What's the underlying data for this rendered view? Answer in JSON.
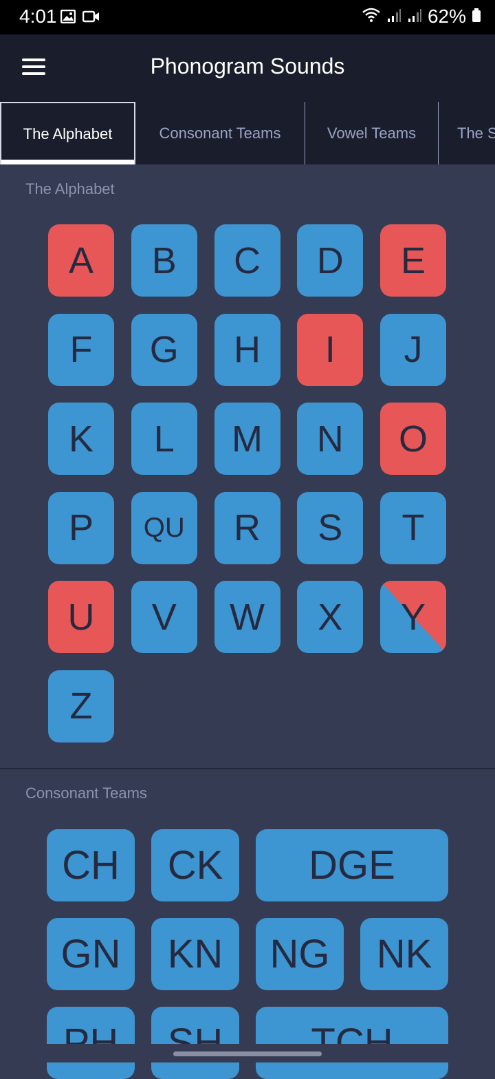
{
  "status_bar": {
    "time": "4:01",
    "battery": "62%",
    "icons": [
      "gallery-icon",
      "video-icon",
      "wifi-icon",
      "signal-icon",
      "signal-icon",
      "battery-icon"
    ]
  },
  "app_bar": {
    "title": "Phonogram Sounds",
    "menu_icon": "hamburger-menu-icon"
  },
  "tabs": [
    {
      "label": "The Alphabet",
      "active": true
    },
    {
      "label": "Consonant Teams",
      "active": false
    },
    {
      "label": "Vowel Teams",
      "active": false
    },
    {
      "label": "The S",
      "active": false
    }
  ],
  "alphabet": {
    "title": "The Alphabet",
    "tiles": [
      {
        "label": "A",
        "color": "red"
      },
      {
        "label": "B",
        "color": "blue"
      },
      {
        "label": "C",
        "color": "blue"
      },
      {
        "label": "D",
        "color": "blue"
      },
      {
        "label": "E",
        "color": "red"
      },
      {
        "label": "F",
        "color": "blue"
      },
      {
        "label": "G",
        "color": "blue"
      },
      {
        "label": "H",
        "color": "blue"
      },
      {
        "label": "I",
        "color": "red"
      },
      {
        "label": "J",
        "color": "blue"
      },
      {
        "label": "K",
        "color": "blue"
      },
      {
        "label": "L",
        "color": "blue"
      },
      {
        "label": "M",
        "color": "blue"
      },
      {
        "label": "N",
        "color": "blue"
      },
      {
        "label": "O",
        "color": "red"
      },
      {
        "label": "P",
        "color": "blue"
      },
      {
        "label": "QU",
        "color": "blue"
      },
      {
        "label": "R",
        "color": "blue"
      },
      {
        "label": "S",
        "color": "blue"
      },
      {
        "label": "T",
        "color": "blue"
      },
      {
        "label": "U",
        "color": "red"
      },
      {
        "label": "V",
        "color": "blue"
      },
      {
        "label": "W",
        "color": "blue"
      },
      {
        "label": "X",
        "color": "blue"
      },
      {
        "label": "Y",
        "color": "split"
      },
      {
        "label": "Z",
        "color": "blue"
      }
    ]
  },
  "consonant_teams": {
    "title": "Consonant Teams",
    "tiles": [
      {
        "label": "CH"
      },
      {
        "label": "CK"
      },
      {
        "label": "DGE"
      },
      {
        "label": "GN"
      },
      {
        "label": "KN"
      },
      {
        "label": "NG"
      },
      {
        "label": "NK"
      },
      {
        "label": "PH"
      },
      {
        "label": "SH"
      },
      {
        "label": "TCH"
      }
    ]
  },
  "colors": {
    "background": "#363b54",
    "app_bar": "#1a1d2b",
    "consonant": "#3d95d1",
    "vowel": "#e85757",
    "tile_text": "#262a40"
  }
}
